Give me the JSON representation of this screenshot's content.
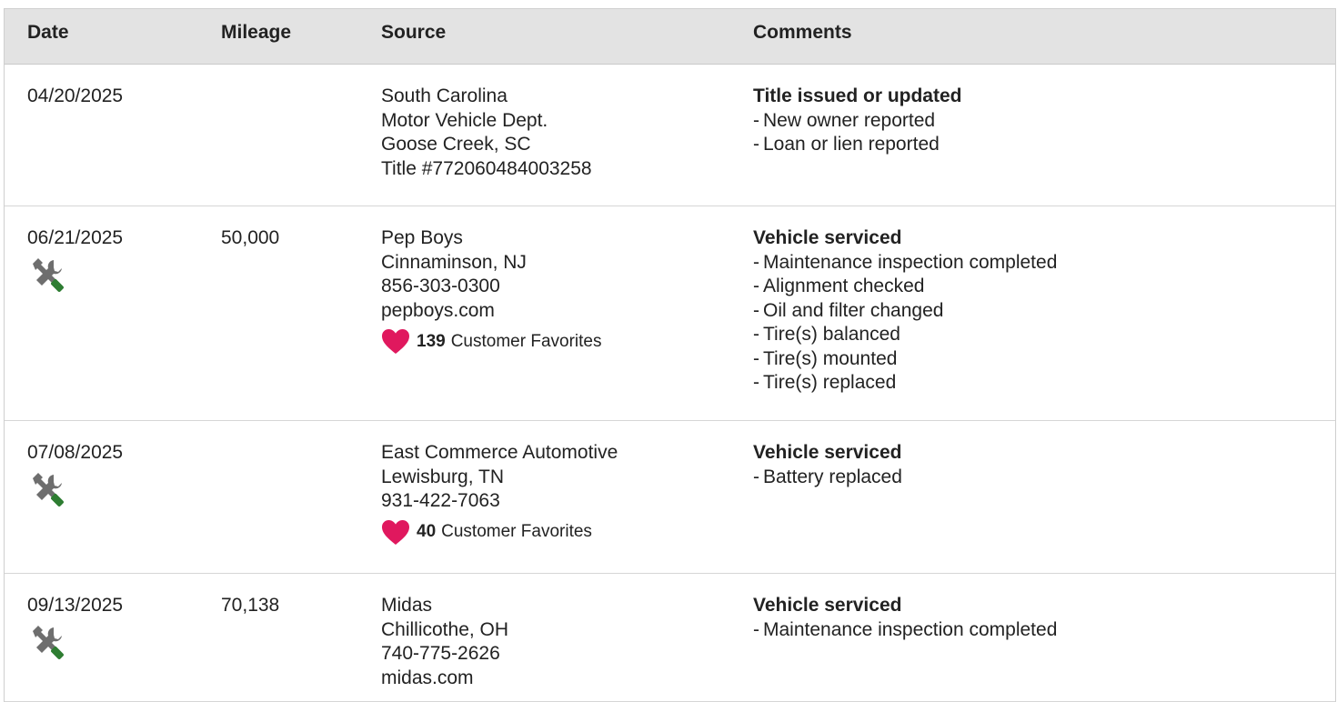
{
  "headers": {
    "date": "Date",
    "mileage": "Mileage",
    "source": "Source",
    "comments": "Comments"
  },
  "colors": {
    "header_bg": "#e3e3e3",
    "heart": "#e0185e",
    "wrench_handle": "#2e7d32",
    "tool_gray": "#6e6e6e"
  },
  "rows": [
    {
      "date": "04/20/2025",
      "mileage": "",
      "service_icon": false,
      "source": [
        "South Carolina",
        "Motor Vehicle Dept.",
        "Goose Creek, SC",
        "Title #772060484003258"
      ],
      "favorites": null,
      "comment_title": "Title issued or updated",
      "comment_items": [
        "New owner reported",
        "Loan or lien reported"
      ]
    },
    {
      "date": "06/21/2025",
      "mileage": "50,000",
      "service_icon": true,
      "source": [
        "Pep Boys",
        "Cinnaminson, NJ",
        "856-303-0300",
        "pepboys.com"
      ],
      "favorites": {
        "count": "139",
        "label": "Customer Favorites"
      },
      "comment_title": "Vehicle serviced",
      "comment_items": [
        "Maintenance inspection completed",
        "Alignment checked",
        "Oil and filter changed",
        "Tire(s) balanced",
        "Tire(s) mounted",
        "Tire(s) replaced"
      ]
    },
    {
      "date": "07/08/2025",
      "mileage": "",
      "service_icon": true,
      "source": [
        "East Commerce Automotive",
        "Lewisburg, TN",
        "931-422-7063"
      ],
      "favorites": {
        "count": "40",
        "label": "Customer Favorites"
      },
      "comment_title": "Vehicle serviced",
      "comment_items": [
        "Battery replaced"
      ]
    },
    {
      "date": "09/13/2025",
      "mileage": "70,138",
      "service_icon": true,
      "source": [
        "Midas",
        "Chillicothe, OH",
        "740-775-2626",
        "midas.com"
      ],
      "favorites": null,
      "comment_title": "Vehicle serviced",
      "comment_items": [
        "Maintenance inspection completed"
      ]
    }
  ]
}
